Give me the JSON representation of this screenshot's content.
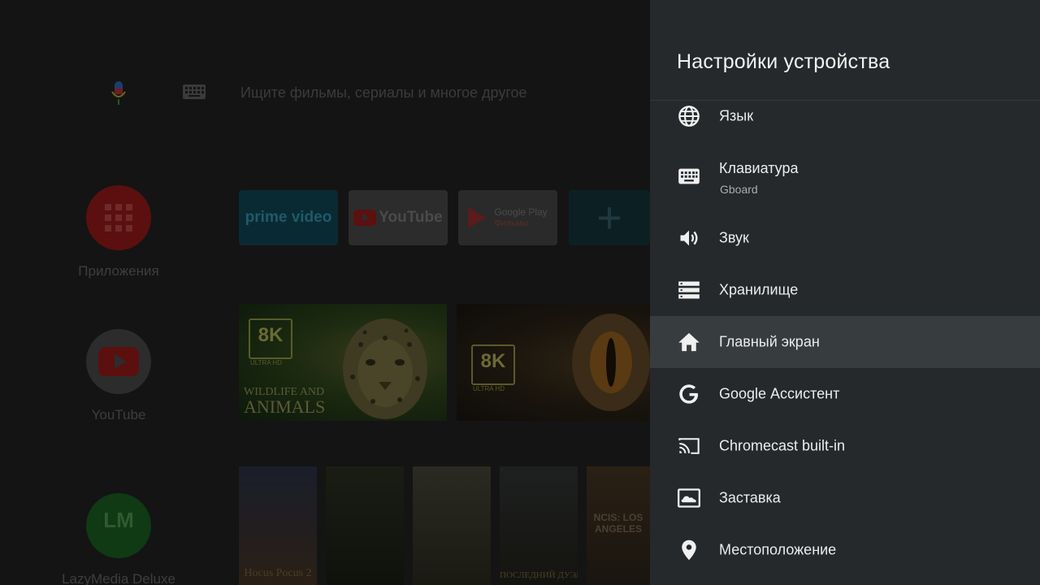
{
  "home": {
    "search_placeholder": "Ищите фильмы, сериалы и многое другое",
    "sidebar_apps": [
      {
        "label": "Приложения",
        "icon": "apps-grid-icon",
        "color": "#5c0f0f"
      },
      {
        "label": "YouTube",
        "icon": "youtube-icon",
        "color": "#2c2c2c"
      },
      {
        "label": "LazyMedia Deluxe",
        "icon": "lazymedia-logo",
        "logo_text": "LM",
        "color": "#0f3a14"
      }
    ],
    "app_tiles": [
      {
        "label": "prime video"
      },
      {
        "label": "YouTube"
      },
      {
        "label": "Google Play",
        "sublabel": "Фильмы"
      },
      {
        "label": "+"
      }
    ],
    "features": [
      {
        "badge": "8K",
        "badge_sub": "ULTRA HD",
        "title_line1": "WILDLIFE AND",
        "title_line2": "ANIMALS"
      },
      {
        "badge": "8K",
        "badge_sub": "ULTRA HD"
      }
    ],
    "posters": [
      {
        "text": "Hocus Pocus 2"
      },
      {
        "text": ""
      },
      {
        "text": ""
      },
      {
        "text": "ПОСЛЕДНИЙ ДУЭЛЬ"
      },
      {
        "text": "NCIS: LOS ANGELES"
      }
    ]
  },
  "settings": {
    "title": "Настройки устройства",
    "items": [
      {
        "label": "Язык",
        "icon": "globe-icon"
      },
      {
        "label": "Клавиатура",
        "sublabel": "Gboard",
        "icon": "keyboard-icon"
      },
      {
        "label": "Звук",
        "icon": "volume-icon"
      },
      {
        "label": "Хранилище",
        "icon": "storage-icon"
      },
      {
        "label": "Главный экран",
        "icon": "home-icon",
        "focused": true
      },
      {
        "label": "Google Ассистент",
        "icon": "google-g-icon"
      },
      {
        "label": "Chromecast built-in",
        "icon": "cast-icon"
      },
      {
        "label": "Заставка",
        "icon": "screensaver-icon"
      },
      {
        "label": "Местоположение",
        "icon": "location-pin-icon"
      }
    ]
  },
  "colors": {
    "panel_bg": "#25292b",
    "focused_bg": "#373c3e",
    "text_primary": "#ececec",
    "text_secondary": "#a8acae"
  }
}
